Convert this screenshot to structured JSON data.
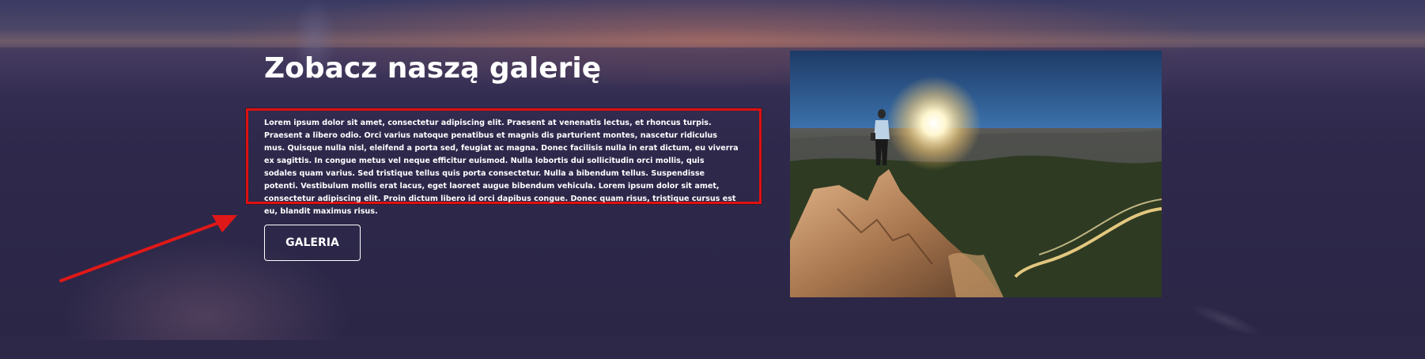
{
  "section": {
    "title": "Zobacz naszą galerię",
    "description": "Lorem ipsum dolor sit amet, consectetur adipiscing elit. Praesent at venenatis lectus, et rhoncus turpis. Praesent a libero odio. Orci varius natoque penatibus et magnis dis parturient montes, nascetur ridiculus mus. Quisque nulla nisl, eleifend a porta sed, feugiat ac magna. Donec facilisis nulla in erat dictum, eu viverra ex sagittis. In congue metus vel neque efficitur euismod. Nulla lobortis dui sollicitudin orci mollis, quis sodales quam varius. Sed tristique tellus quis porta consectetur. Nulla a bibendum tellus. Suspendisse potenti. Vestibulum mollis erat lacus, eget laoreet augue bibendum vehicula. Lorem ipsum dolor sit amet, consectetur adipiscing elit. Proin dictum libero id orci dapibus congue. Donec quam risus, tristique cursus est eu, blandit maximus risus.",
    "button_label": "GALERIA"
  },
  "annotation": {
    "highlight_color": "#dd1111",
    "arrow_color": "#e01818"
  },
  "colors": {
    "background": "#2d2748",
    "text": "#ffffff"
  }
}
